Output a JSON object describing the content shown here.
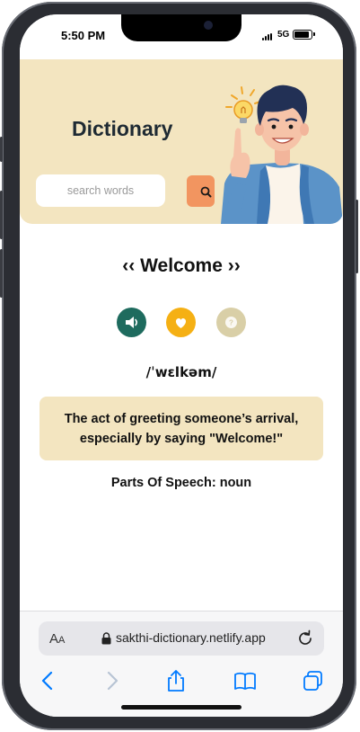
{
  "status_bar": {
    "time": "5:50 PM",
    "network": "5G"
  },
  "app": {
    "title": "Dictionary"
  },
  "search": {
    "placeholder": "search words",
    "value": ""
  },
  "word": {
    "display": "‹‹ Welcome ››",
    "phonetic": "/ˈwɛlkəm/"
  },
  "actions": [
    {
      "name": "speaker-icon",
      "color": "#1e6b5e"
    },
    {
      "name": "heart-icon",
      "color": "#f5b014"
    },
    {
      "name": "help-icon",
      "color": "#d9cfa7"
    }
  ],
  "definition": {
    "text": "The act of greeting someone’s arrival, especially by saying \"Welcome!\""
  },
  "parts_of_speech": {
    "text": "Parts Of Speech: noun"
  },
  "browser": {
    "aa_label": "AA",
    "url": "sakthi-dictionary.netlify.app"
  },
  "colors": {
    "header_bg": "#f3e5c0",
    "search_button": "#f29560",
    "ios_blue": "#007aff"
  }
}
